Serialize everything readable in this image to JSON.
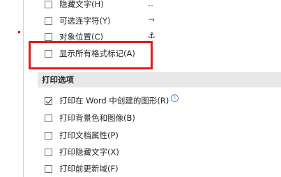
{
  "display_options": {
    "items": [
      {
        "label": "隐藏文字(H)",
        "checked": false,
        "mark": "‥"
      },
      {
        "label": "可选连字符(Y)",
        "checked": false,
        "mark": "¬"
      },
      {
        "label": "对象位置(C)",
        "checked": false,
        "mark": "⚓"
      },
      {
        "label": "显示所有格式标记(A)",
        "checked": false
      }
    ]
  },
  "print_options": {
    "title": "打印选项",
    "items": [
      {
        "label": "打印在 Word 中创建的图形(R)",
        "checked": true
      },
      {
        "label": "打印背景色和图像(B)",
        "checked": false
      },
      {
        "label": "打印文档属性(P)",
        "checked": false
      },
      {
        "label": "打印隐藏文字(X)",
        "checked": false
      },
      {
        "label": "打印前更新域(F)",
        "checked": false
      }
    ]
  },
  "colors": {
    "highlight": "#e21b1b",
    "section_bg": "#e8e8e8",
    "info": "#4a8ad8"
  },
  "icons": [
    "info-icon",
    "checkbox",
    "checkmark-icon",
    "anchor-icon"
  ]
}
